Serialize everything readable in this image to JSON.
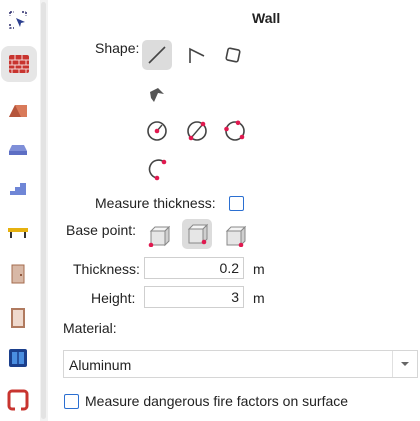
{
  "sidebar": {
    "tools": [
      {
        "name": "select-tool",
        "icon": "cursor-select-icon"
      },
      {
        "name": "wall-tool",
        "icon": "brick-wall-icon",
        "active": true
      },
      {
        "name": "roof-tool",
        "icon": "roof-icon"
      },
      {
        "name": "slab-tool",
        "icon": "slab-icon"
      },
      {
        "name": "stairs-tool",
        "icon": "stairs-icon"
      },
      {
        "name": "beam-tool",
        "icon": "beam-icon"
      },
      {
        "name": "door-tool",
        "icon": "door-icon"
      },
      {
        "name": "door2-tool",
        "icon": "door-frame-icon"
      },
      {
        "name": "window-tool",
        "icon": "window-icon"
      },
      {
        "name": "opening-tool",
        "icon": "opening-icon"
      }
    ]
  },
  "panel": {
    "title": "Wall",
    "shape_label": "Shape:",
    "measure_thickness_label": "Measure thickness:",
    "measure_thickness_checked": false,
    "base_point_label": "Base point:",
    "base_point_selected": 1,
    "thickness_label": "Thickness:",
    "thickness_value": "0.2",
    "thickness_unit": "m",
    "height_label": "Height:",
    "height_value": "3",
    "height_unit": "m",
    "material_label": "Material:",
    "material_value": "Aluminum",
    "fire_label": "Measure dangerous fire factors on surface",
    "fire_checked": false
  },
  "colors": {
    "accent": "#2b6fd1",
    "point": "#e0194f",
    "brick": "#c8342f"
  }
}
